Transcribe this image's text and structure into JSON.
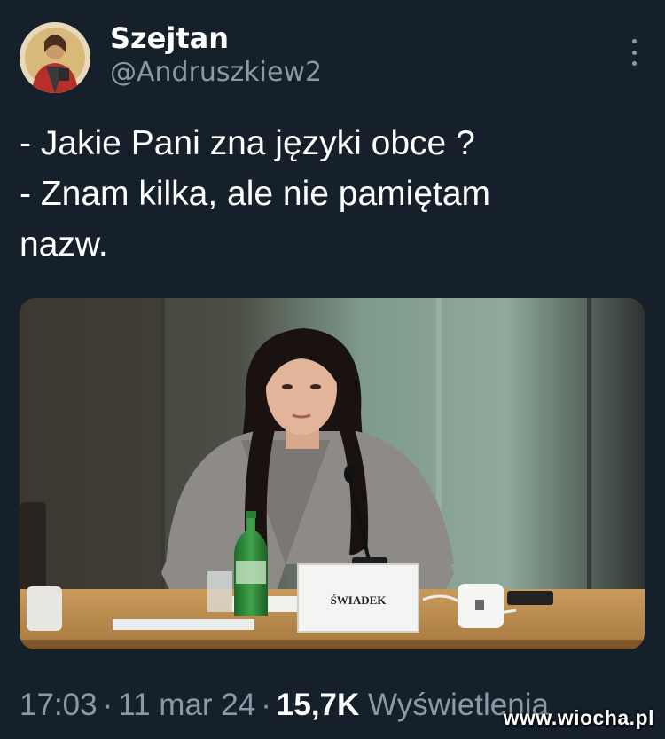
{
  "author": {
    "display_name": "Szejtan",
    "handle": "@Andruszkiew2"
  },
  "tweet": {
    "lines": [
      "- Jakie Pani zna języki obce ?",
      "- Znam kilka, ale nie pamiętam",
      "nazw."
    ]
  },
  "media": {
    "nameplate_text": "ŚWIADEK"
  },
  "meta": {
    "time": "17:03",
    "separator": "·",
    "date": "11 mar 24",
    "views_count": "15,7K",
    "views_label": "Wyświetlenia"
  },
  "watermark": "www.wiocha.pl",
  "icons": {
    "more": "more-vertical-icon"
  },
  "colors": {
    "background": "#15202b",
    "text_primary": "#ffffff",
    "text_secondary": "#8b98a5"
  }
}
